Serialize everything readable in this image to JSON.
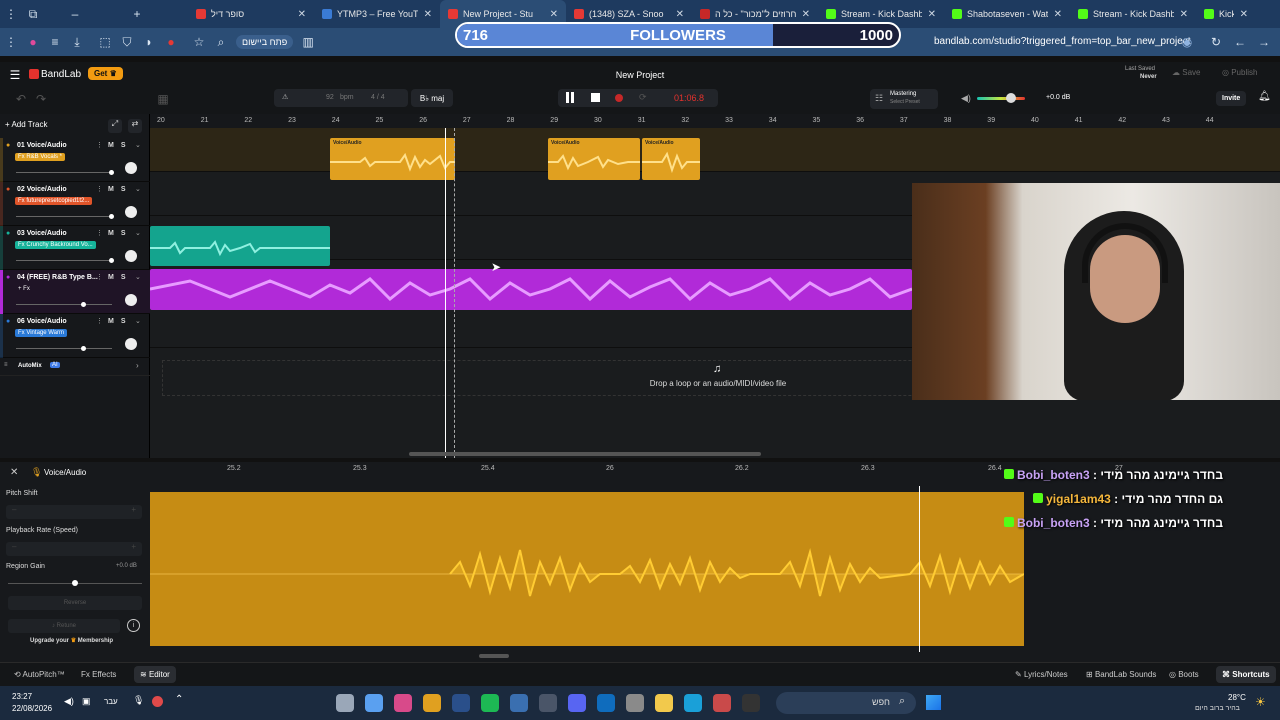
{
  "browser": {
    "tabs": [
      {
        "label": "סופר דיל",
        "color": "#e53935"
      },
      {
        "label": "YTMP3 – Free YouTu",
        "color": "#3a7bd5"
      },
      {
        "label": "New Project - Stu",
        "color": "#e53935"
      },
      {
        "label": "(1348) SZA - Snoo",
        "color": "#e53935"
      },
      {
        "label": "חרוזים ל\"מכור\" - כל ה",
        "color": "#c62828"
      },
      {
        "label": "Stream - Kick Dashbo",
        "color": "#53fc18"
      },
      {
        "label": "Shabotaseven - Watc",
        "color": "#53fc18"
      },
      {
        "label": "Stream - Kick Dashbo",
        "color": "#53fc18"
      },
      {
        "label": "Kick",
        "color": "#53fc18"
      }
    ],
    "hebrew_button": "פתח ביישום",
    "url": "bandlab.com/studio?triggered_from=top_bar_new_project"
  },
  "followers_overlay": {
    "current": "716",
    "label": "FOLLOWERS",
    "goal": "1000",
    "progress": 0.716
  },
  "bandlab": {
    "brand": "BandLab",
    "get_label": "Get",
    "project_title": "New Project",
    "last_saved_label": "Last Saved",
    "last_saved_value": "Never",
    "save_label": "Save",
    "publish_label": "Publish",
    "bpm_value": "92",
    "bpm_unit": "bpm",
    "time_signature": "4 / 4",
    "key": "B♭ maj",
    "time": "01:06.8",
    "mastering_label": "Mastering",
    "mastering_preset": "Select Preset",
    "volume_db": "+0.0 dB",
    "invite_label": "Invite",
    "add_track_label": "Add Track",
    "automix_label": "AutoMix",
    "automix_badge": "AI",
    "drop_hint": "Drop a loop or an audio/MIDI/video file"
  },
  "ruler_numbers": [
    "20",
    "21",
    "22",
    "23",
    "24",
    "25",
    "26",
    "27",
    "28",
    "29",
    "30",
    "31",
    "32",
    "33",
    "34",
    "35",
    "36",
    "37",
    "38",
    "39",
    "40",
    "41",
    "42",
    "43",
    "44"
  ],
  "tracks": [
    {
      "num": "01",
      "name": "Voice/Audio",
      "fx": "Fx R&B Vocals *",
      "fx_color": "#e0a020",
      "stripe": "#e0a020"
    },
    {
      "num": "02",
      "name": "Voice/Audio",
      "fx": "Fx futurepresetcopied1t2...",
      "fx_color": "#e0552a",
      "stripe": "#e0552a"
    },
    {
      "num": "03",
      "name": "Voice/Audio",
      "fx": "Fx Crunchy Backround Vo...",
      "fx_color": "#16b39a",
      "stripe": "#16b39a"
    },
    {
      "num": "04",
      "name": "(FREE) R&B Type B...",
      "fx": "+ Fx",
      "fx_color": "transparent",
      "stripe": "#b12ad8"
    },
    {
      "num": "06",
      "name": "Voice/Audio",
      "fx": "Fx Vintage Warm",
      "fx_color": "#2a7ad8",
      "stripe": "#2a7ad8"
    }
  ],
  "clips": {
    "clip_label": "Voice/Audio"
  },
  "editor": {
    "track_label": "Voice/Audio",
    "ruler": [
      "25.2",
      "25.3",
      "25.4",
      "26",
      "26.2",
      "26.3",
      "26.4",
      "27"
    ],
    "pitch_shift_label": "Pitch Shift",
    "playback_rate_label": "Playback Rate (Speed)",
    "region_gain_label": "Region Gain",
    "region_gain_value": "+0.0 dB",
    "reverse_label": "Reverse",
    "retune_label": "Retune",
    "upgrade_label": "Upgrade your",
    "membership_label": "Membership"
  },
  "chat": [
    {
      "user": "Bobi_boten3",
      "msg": "בחדר גיימינג מהר מידי",
      "color": "#c8a2f5"
    },
    {
      "user": "yigal1am43",
      "msg": "גם החדר מהר מידי",
      "color": "#f5b73c"
    },
    {
      "user": "Bobi_boten3",
      "msg": "בחדר גיימינג מהר מידי",
      "color": "#c8a2f5"
    }
  ],
  "bottom_bar": {
    "autopitch": "AutoPitch™",
    "effects": "Effects",
    "editor": "Editor",
    "lyrics": "Lyrics/Notes",
    "sounds": "BandLab Sounds",
    "boots": "Boots",
    "shortcuts": "Shortcuts"
  },
  "taskbar": {
    "time": "23:27",
    "date": "22/08/2026",
    "lang": "עבר",
    "search": "חפש",
    "temp": "28°C",
    "weather": "בהיר ברוב היום"
  }
}
